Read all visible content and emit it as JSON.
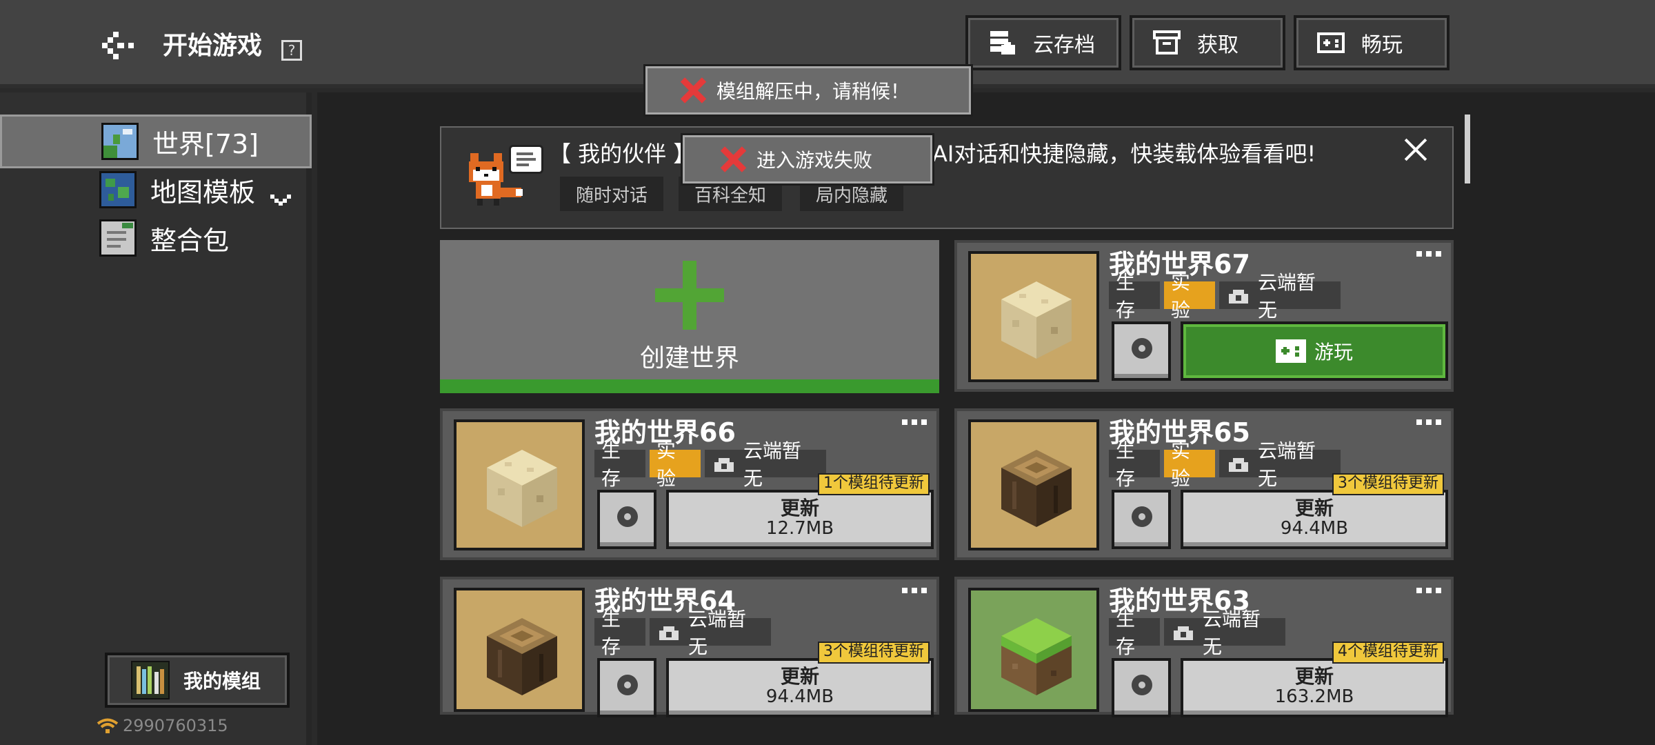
{
  "header": {
    "title": "开始游戏",
    "help_label": "?",
    "buttons": [
      {
        "label": "云存档",
        "icon": "cloud-save-icon"
      },
      {
        "label": "获取",
        "icon": "store-icon"
      },
      {
        "label": "畅玩",
        "icon": "gamepad-icon"
      }
    ]
  },
  "toasts": [
    {
      "text": "模组解压中，请稍候！",
      "icon": "error-x-icon"
    },
    {
      "text": "进入游戏失败",
      "icon": "error-x-icon"
    }
  ],
  "sidebar": {
    "items": [
      {
        "label": "世界[73]",
        "icon": "world-icon",
        "selected": true
      },
      {
        "label": "地图模板",
        "icon": "globe-icon",
        "expandable": true
      },
      {
        "label": "整合包",
        "icon": "pack-icon"
      }
    ],
    "my_mods_label": "我的模组",
    "user_id": "2990760315"
  },
  "banner": {
    "title": "【 我的伙伴 】",
    "text": "AI对话和快捷隐藏，快装载体验看看吧!",
    "tags": [
      "随时对话",
      "百科全知",
      "局内隐藏"
    ]
  },
  "create_world": {
    "label": "创建世界"
  },
  "worlds": [
    {
      "name": "我的世界67",
      "mode": "生存",
      "experimental": "实验",
      "cloud": "云端暂无",
      "action": "游玩",
      "thumb": "sand-block"
    },
    {
      "name": "我的世界66",
      "mode": "生存",
      "experimental": "实验",
      "cloud": "云端暂无",
      "action": "更新",
      "size": "12.7MB",
      "badge": "1个模组待更新",
      "thumb": "sand-block"
    },
    {
      "name": "我的世界65",
      "mode": "生存",
      "experimental": "实验",
      "cloud": "云端暂无",
      "action": "更新",
      "size": "94.4MB",
      "badge": "3个模组待更新",
      "thumb": "log-block"
    },
    {
      "name": "我的世界64",
      "mode": "生存",
      "cloud": "云端暂无",
      "action": "更新",
      "size": "94.4MB",
      "badge": "3个模组待更新",
      "thumb": "log-block"
    },
    {
      "name": "我的世界63",
      "mode": "生存",
      "cloud": "云端暂无",
      "action": "更新",
      "size": "163.2MB",
      "badge": "4个模组待更新",
      "thumb": "grass-block"
    }
  ],
  "colors": {
    "accent_green": "#3c8a2c",
    "experimental": "#e6a21e",
    "badge": "#f0c83c",
    "error": "#e53a3a"
  }
}
